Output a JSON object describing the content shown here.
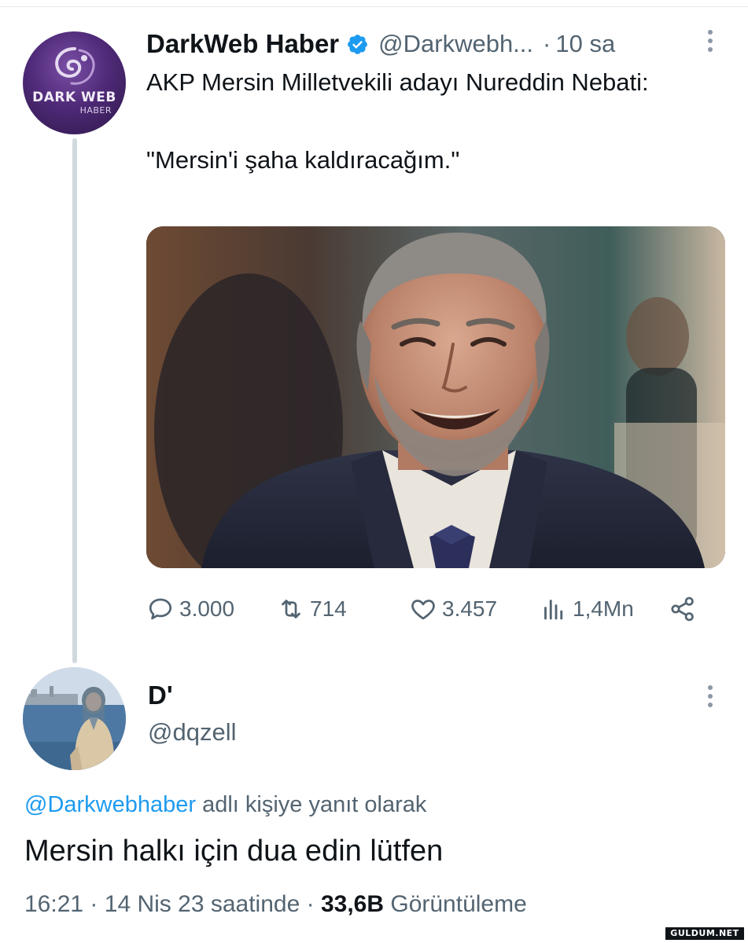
{
  "tweet": {
    "author_name": "DarkWeb Haber",
    "author_handle": "@Darkwebh...",
    "time_separator": "·",
    "time_ago": "10 sa",
    "avatar_text_1": "DARK WEB",
    "avatar_text_2": "HABER",
    "text_line_1": "AKP Mersin Milletvekili adayı Nureddin Nebati:",
    "text_line_2": "\"Mersin'i şaha kaldıracağım.\"",
    "stats": {
      "replies": "3.000",
      "retweets": "714",
      "likes": "3.457",
      "views": "1,4Mn"
    }
  },
  "reply": {
    "author_name": "D'",
    "author_handle": "@dqzell",
    "replying_to_handle": "@Darkwebhaber",
    "replying_to_suffix": "adlı kişiye yanıt olarak",
    "text": "Mersin halkı için dua edin lütfen",
    "time": "16:21",
    "date": "14 Nis 23 saatinde",
    "views_count": "33,6B",
    "views_label": "Görüntüleme"
  },
  "watermark": "GULDUM.NET",
  "colors": {
    "text_primary": "#0f1419",
    "text_secondary": "#536471",
    "link": "#1d9bf0",
    "verified": "#1d9bf0",
    "thread_line": "#cfd9de"
  },
  "icons": {
    "verified": "verified-badge-icon",
    "more": "more-vertical-icon",
    "reply": "reply-bubble-icon",
    "retweet": "retweet-icon",
    "like": "heart-icon",
    "views": "views-bar-chart-icon",
    "share": "share-icon"
  }
}
